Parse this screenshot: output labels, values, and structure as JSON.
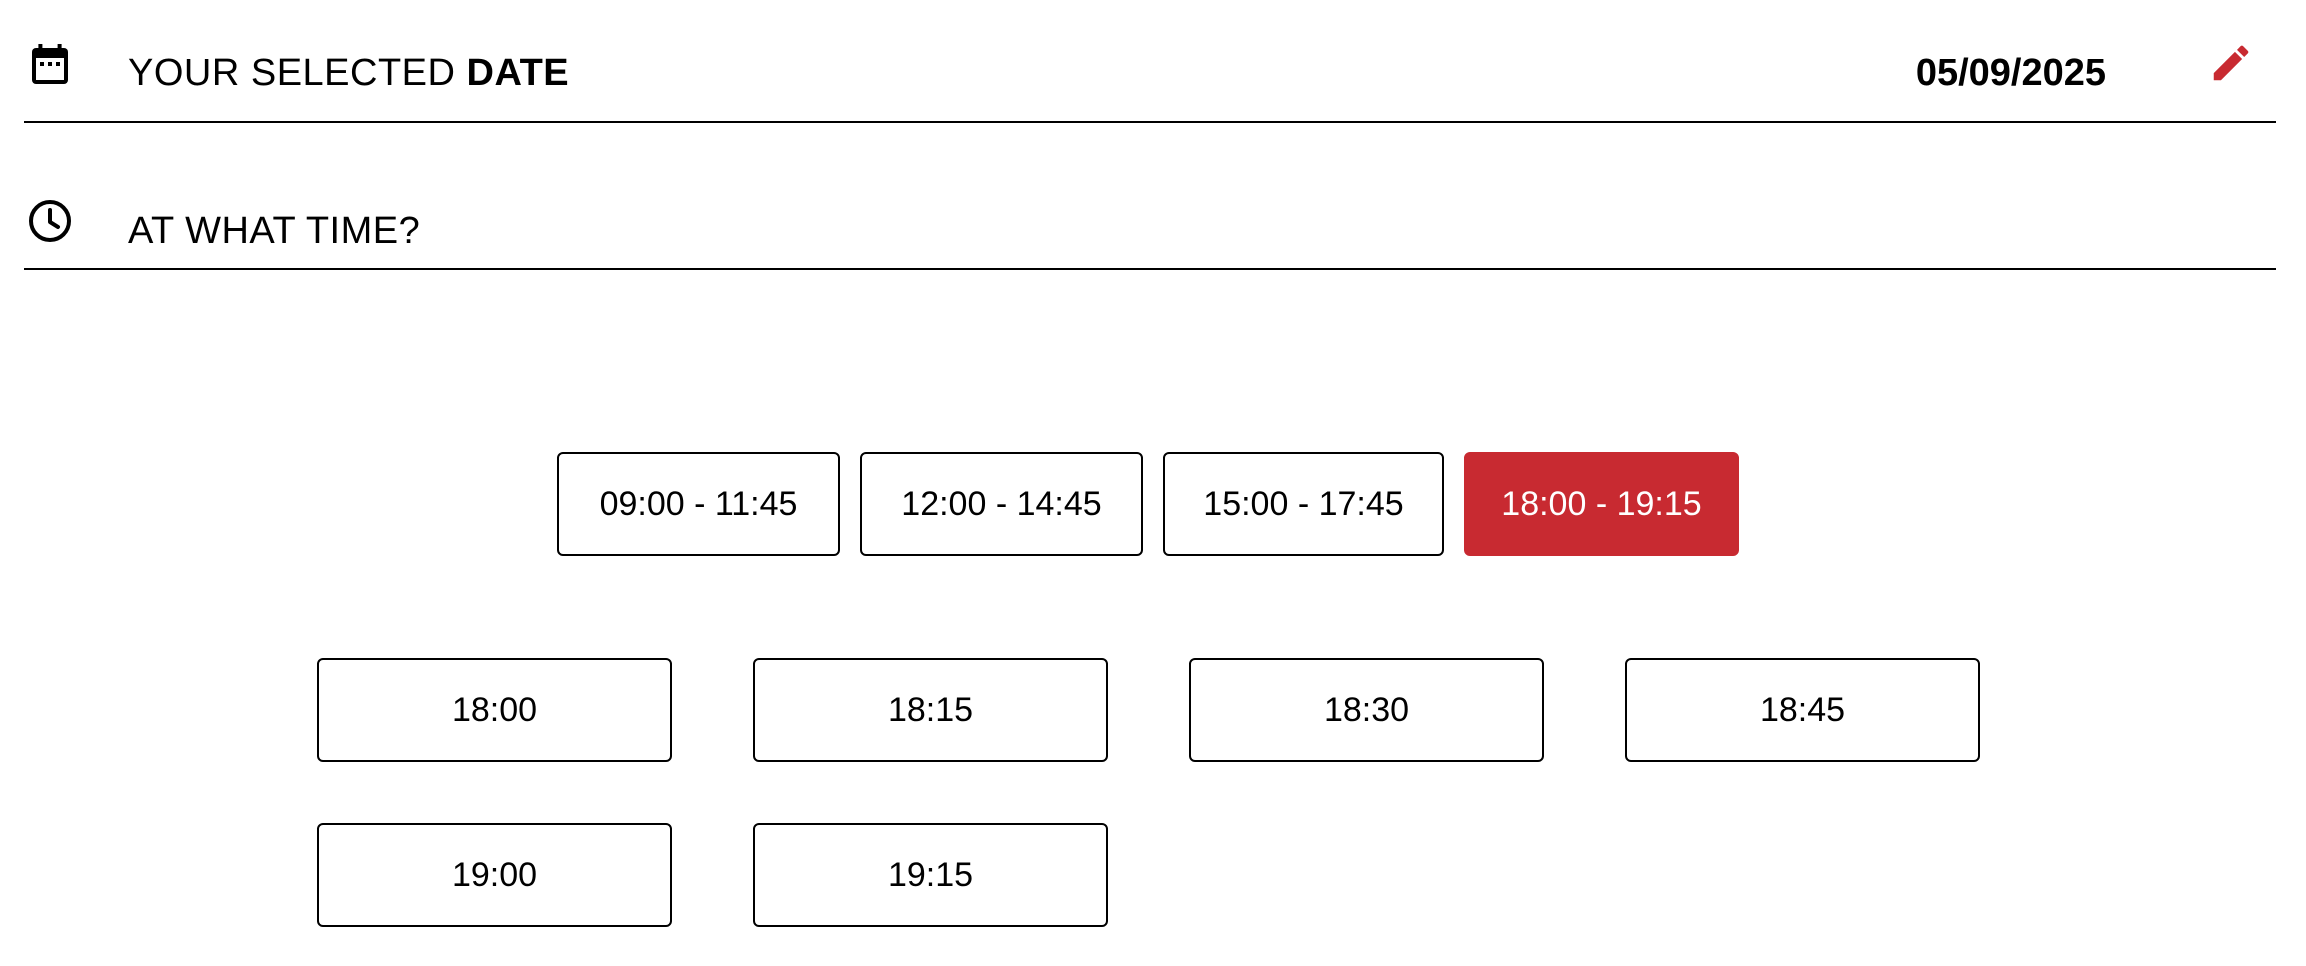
{
  "date_section": {
    "icon": "calendar-icon",
    "label_light": "YOUR SELECTED ",
    "label_bold": "DATE",
    "value": "05/09/2025",
    "edit_icon": "pencil-icon"
  },
  "time_section": {
    "icon": "clock-icon",
    "label": "AT WHAT TIME?"
  },
  "colors": {
    "accent": "#c82a31",
    "border": "#000000",
    "background": "#ffffff"
  },
  "time_ranges": [
    {
      "label": "09:00 - 11:45",
      "selected": false
    },
    {
      "label": "12:00 - 14:45",
      "selected": false
    },
    {
      "label": "15:00 - 17:45",
      "selected": false
    },
    {
      "label": "18:00 - 19:15",
      "selected": true
    }
  ],
  "time_slots": [
    "18:00",
    "18:15",
    "18:30",
    "18:45",
    "19:00",
    "19:15"
  ]
}
